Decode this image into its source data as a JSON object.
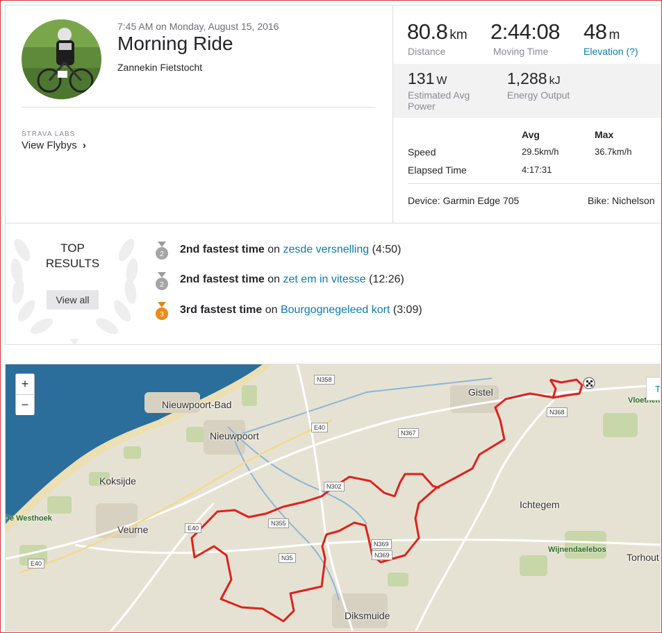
{
  "activity": {
    "datetime": "7:45 AM on Monday, August 15, 2016",
    "title": "Morning Ride",
    "description": "Zannekin Fietstocht"
  },
  "labs": {
    "caption": "STRAVA LABS",
    "link": "View Flybys",
    "chevron": "›"
  },
  "stats": {
    "distance": {
      "value": "80.8",
      "unit": "km",
      "label": "Distance"
    },
    "moving_time": {
      "value": "2:44:08",
      "label": "Moving Time"
    },
    "elevation": {
      "value": "48",
      "unit": "m",
      "label": "Elevation (?)"
    },
    "power": {
      "value": "131",
      "unit": "W",
      "label_line1": "Estimated Avg",
      "label_line2": "Power"
    },
    "energy": {
      "value": "1,288",
      "unit": "kJ",
      "label": "Energy Output"
    }
  },
  "details": {
    "col_avg": "Avg",
    "col_max": "Max",
    "rows": [
      {
        "label": "Speed",
        "avg": "29.5km/h",
        "max": "36.7km/h"
      },
      {
        "label": "Elapsed Time",
        "avg": "4:17:31",
        "max": ""
      }
    ],
    "device": "Device: Garmin Edge 705",
    "bike": "Bike: Nichelson"
  },
  "top_results": {
    "heading_line1": "TOP",
    "heading_line2": "RESULTS",
    "view_all": "View all",
    "items": [
      {
        "rank": "2",
        "medal": "silver",
        "achievement": "2nd fastest time",
        "on": "on",
        "segment": "zesde versnelling",
        "time": "(4:50)"
      },
      {
        "rank": "2",
        "medal": "silver",
        "achievement": "2nd fastest time",
        "on": "on",
        "segment": "zet em in vitesse",
        "time": "(12:26)"
      },
      {
        "rank": "3",
        "medal": "bronze",
        "achievement": "3rd fastest time",
        "on": "on",
        "segment": "Bourgognegeleed kort",
        "time": "(3:09)"
      }
    ]
  },
  "map": {
    "zoom_in": "+",
    "zoom_out": "−",
    "corner_button": "Te",
    "towns": [
      "Gistel",
      "Nieuwpoort-Bad",
      "Nieuwpoort",
      "Koksijde",
      "Ichtegem",
      "Veurne",
      "Diksmuide",
      "Torhout"
    ],
    "places_green": [
      "Vloethemveld",
      "De Westhoek",
      "Wijnendaelebos"
    ],
    "roads": [
      "N358",
      "E40",
      "N367",
      "N368",
      "N302",
      "N355",
      "E40",
      "N369",
      "N35",
      "N369",
      "E40"
    ],
    "colors": {
      "route": "#e0201b",
      "sea": "#2b6e9b",
      "land": "#e6e2d3"
    }
  }
}
